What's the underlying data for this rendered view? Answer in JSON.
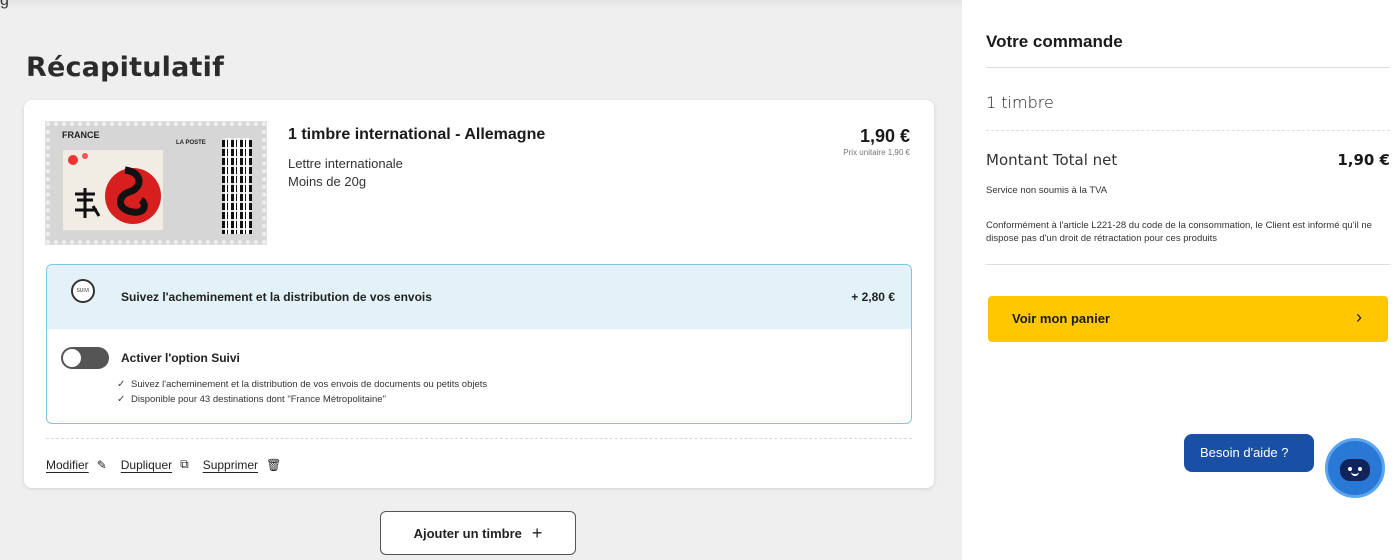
{
  "summary": {
    "cut_text": "g",
    "title": "Récapitulatif",
    "product": {
      "stamp_country": "FRANCE",
      "stamp_brand": "LA POSTE",
      "title": "1 timbre international - Allemagne",
      "type": "Lettre internationale",
      "weight": "Moins de 20g",
      "price": "1,90 €",
      "unit_price": "Prix unitaire 1,90 €"
    },
    "tracking": {
      "logo_text": "SUIVI",
      "headline": "Suivez l'acheminement et la distribution de vos envois",
      "price": "+ 2,80 €",
      "toggle_label": "Activer l'option Suivi",
      "toggle_on": false,
      "bullets": [
        "Suivez l'acheminement et la distribution de vos envois de documents ou petits objets",
        "Disponible pour 43 destinations dont \"France Métropolitaine\""
      ]
    },
    "actions": {
      "modify": "Modifier",
      "duplicate": "Dupliquer",
      "delete": "Supprimer"
    },
    "add_button": "Ajouter un timbre"
  },
  "order": {
    "title": "Votre commande",
    "quantity": "1 timbre",
    "total_label": "Montant Total net",
    "total_value": "1,90 €",
    "tva_note": "Service non soumis à la TVA",
    "legal_note": "Conformément à l'article L221-28 du code de la consommation, le Client est informé qu'il ne dispose pas d'un droit de rétractation pour ces produits",
    "cart_button": "Voir mon panier"
  },
  "help": {
    "label": "Besoin d'aide ?"
  },
  "colors": {
    "accent_yellow": "#ffc700",
    "help_blue": "#1a4fa6",
    "tracking_bg": "#e3f2f8",
    "tracking_border": "#7fc6df"
  },
  "icons": {
    "edit": "pencil-icon",
    "duplicate": "duplicate-icon",
    "delete": "trash-icon",
    "add": "plus-icon",
    "cart_chevron": "chevron-right-icon",
    "chatbot": "chatbot-icon"
  }
}
